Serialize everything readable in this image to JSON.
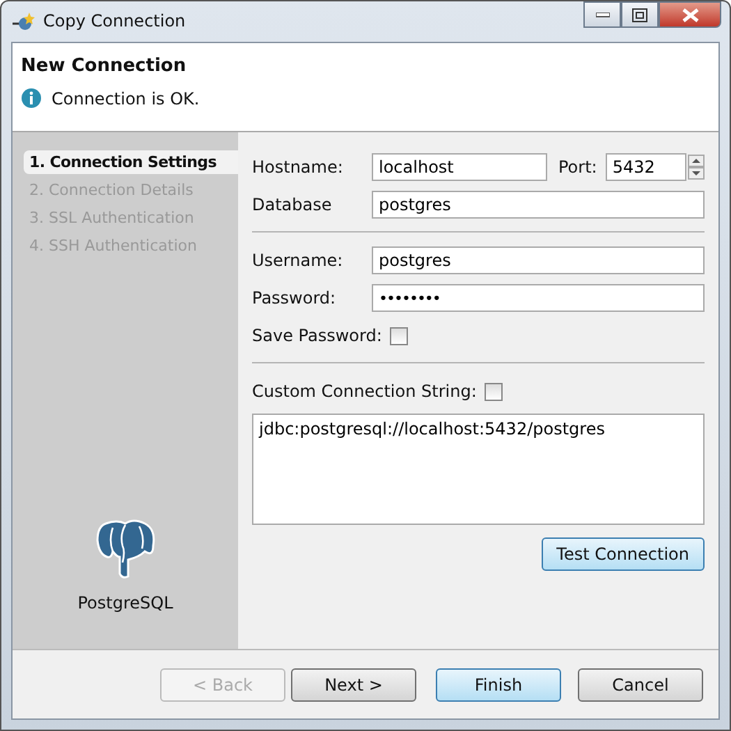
{
  "window": {
    "title": "Copy Connection"
  },
  "header": {
    "title": "New Connection",
    "message": "Connection is OK."
  },
  "steps": [
    {
      "label": "1. Connection Settings",
      "selected": true
    },
    {
      "label": "2. Connection Details",
      "selected": false
    },
    {
      "label": "3. SSL Authentication",
      "selected": false
    },
    {
      "label": "4. SSH Authentication",
      "selected": false
    }
  ],
  "driver": {
    "name": "PostgreSQL"
  },
  "form": {
    "hostname": {
      "label": "Hostname:",
      "value": "localhost"
    },
    "port": {
      "label": "Port:",
      "value": "5432"
    },
    "database": {
      "label": "Database",
      "value": "postgres"
    },
    "username": {
      "label": "Username:",
      "value": "postgres"
    },
    "password": {
      "label": "Password:",
      "value": "••••••••"
    },
    "save_password": {
      "label": "Save Password:",
      "checked": false
    },
    "custom_string": {
      "label": "Custom Connection String:",
      "checked": false
    },
    "connection_string": {
      "value": "jdbc:postgresql://localhost:5432/postgres"
    },
    "test_button": {
      "label": "Test Connection",
      "highlighted": true
    }
  },
  "buttons": [
    {
      "label": "< Back",
      "disabled": true,
      "highlighted": false
    },
    {
      "label": "Next >",
      "disabled": false,
      "highlighted": false
    },
    {
      "label": "Finish",
      "disabled": false,
      "highlighted": true
    },
    {
      "label": "Cancel",
      "disabled": false,
      "highlighted": false
    }
  ]
}
